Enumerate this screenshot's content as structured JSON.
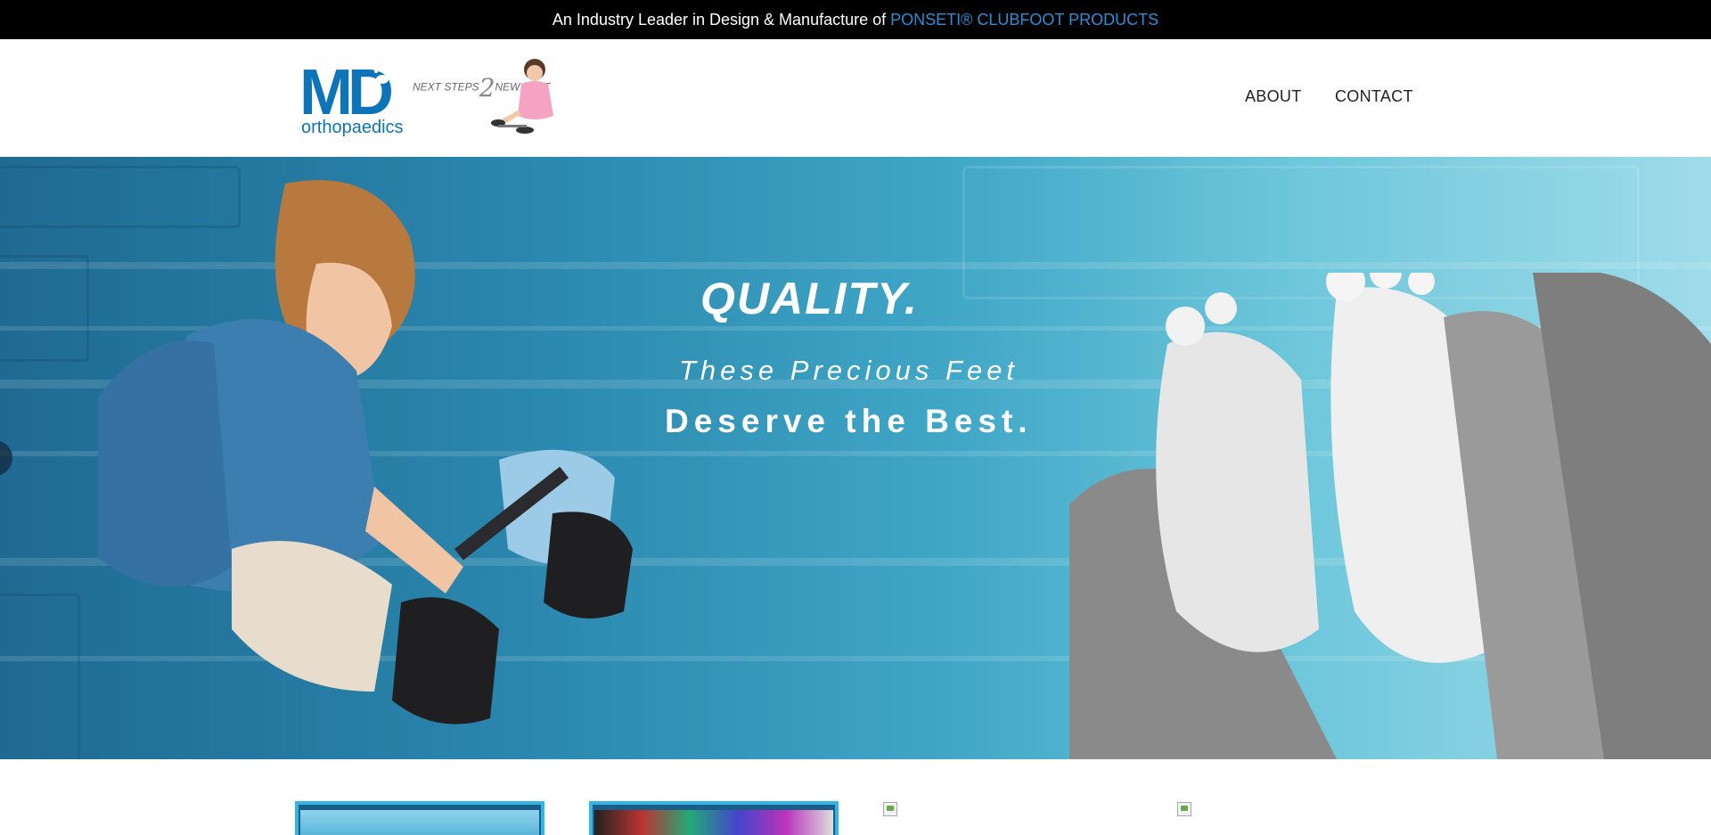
{
  "topbar": {
    "text": "An Industry Leader in Design & Manufacture of",
    "highlight": "PONSETI® CLUBFOOT PRODUCTS",
    "highlight_color": "#2a8fd6"
  },
  "header": {
    "logo": {
      "main": "MD",
      "sub": "orthopaedics",
      "color": "#0d74b9"
    },
    "tagline": {
      "part1": "NEXT STEPS",
      "part2": "2",
      "part3": "NEW FEET"
    },
    "nav": {
      "about": "ABOUT",
      "contact": "CONTACT"
    }
  },
  "hero": {
    "title": "QUALITY.",
    "line1": "These Precious Feet",
    "line2": "Deserve the Best."
  },
  "products": {
    "tiles": [
      {
        "icon": "product-image"
      },
      {
        "icon": "product-image"
      },
      {
        "icon": "broken-image-icon"
      },
      {
        "icon": "broken-image-icon"
      }
    ]
  }
}
